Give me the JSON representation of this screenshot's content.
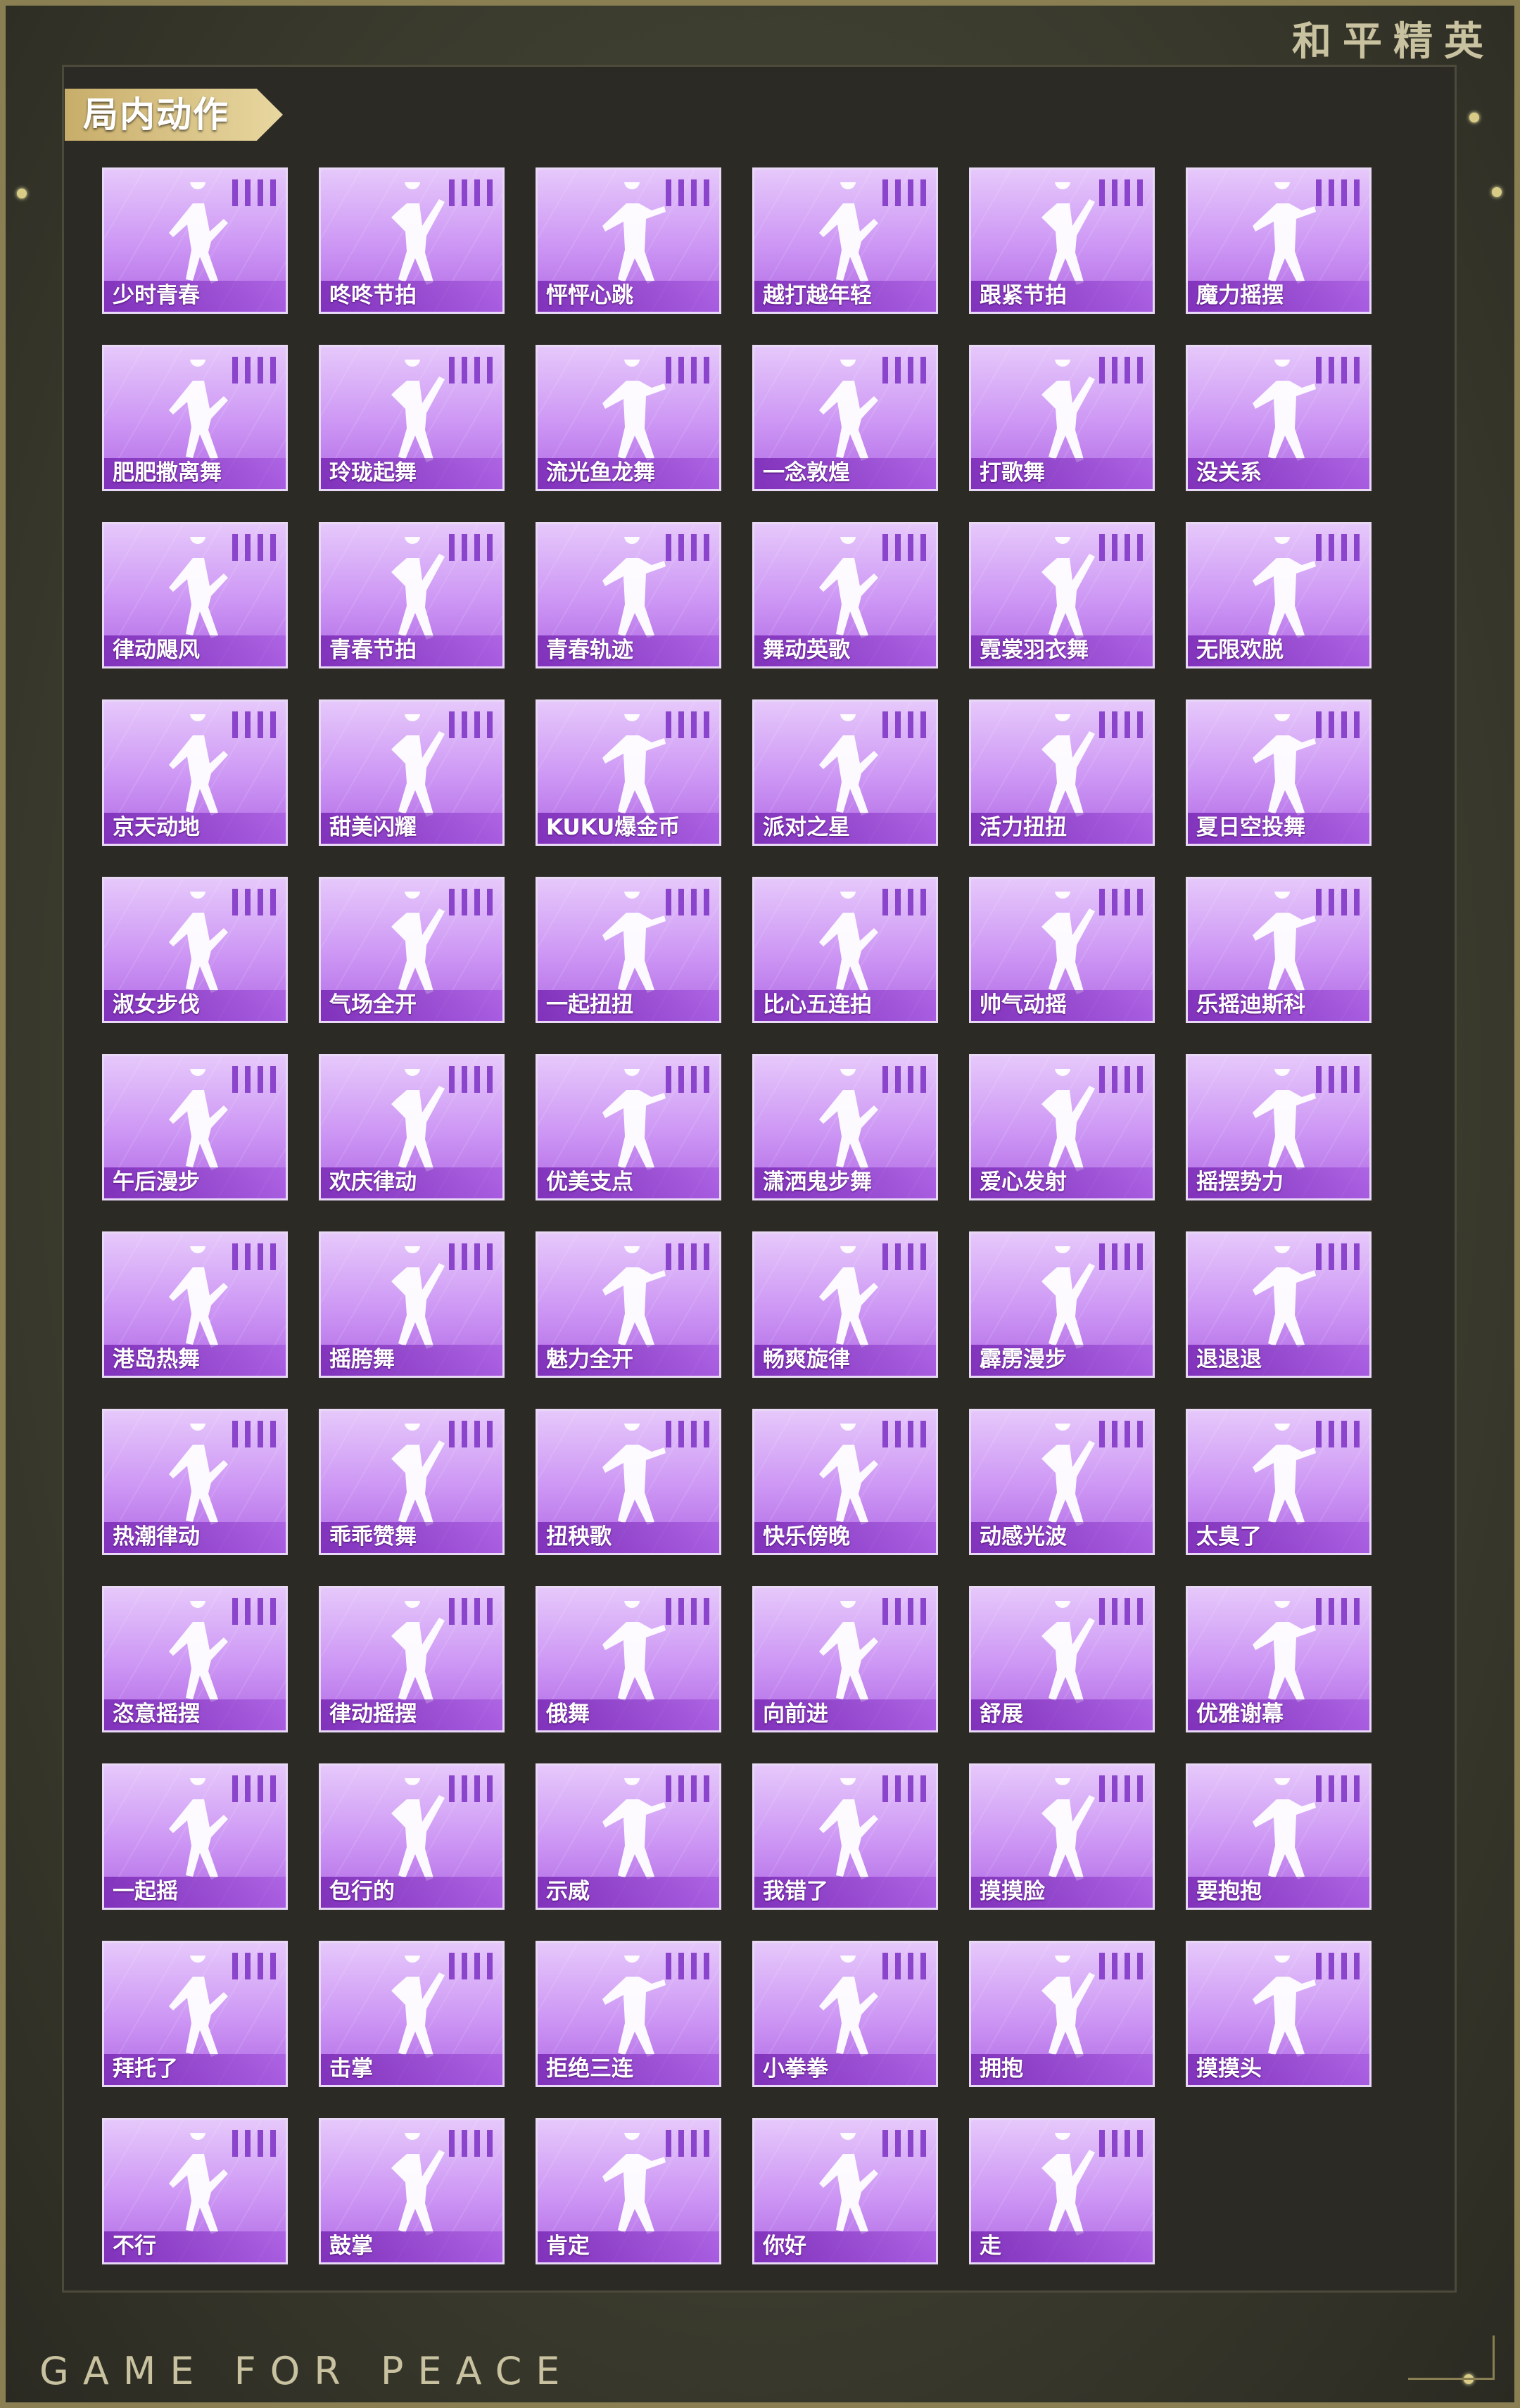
{
  "brand": "和平精英",
  "section_title": "局内动作",
  "footer": "GAME FOR PEACE",
  "figure_icon": "dancer-silhouette-icon",
  "actions": [
    "少时青春",
    "咚咚节拍",
    "怦怦心跳",
    "越打越年轻",
    "跟紧节拍",
    "魔力摇摆",
    "肥肥撒离舞",
    "玲珑起舞",
    "流光鱼龙舞",
    "一念敦煌",
    "打歌舞",
    "没关系",
    "律动飓风",
    "青春节拍",
    "青春轨迹",
    "舞动英歌",
    "霓裳羽衣舞",
    "无限欢脱",
    "京天动地",
    "甜美闪耀",
    "KUKU爆金币",
    "派对之星",
    "活力扭扭",
    "夏日空投舞",
    "淑女步伐",
    "气场全开",
    "一起扭扭",
    "比心五连拍",
    "帅气动摇",
    "乐摇迪斯科",
    "午后漫步",
    "欢庆律动",
    "优美支点",
    "潇洒鬼步舞",
    "爱心发射",
    "摇摆势力",
    "港岛热舞",
    "摇胯舞",
    "魅力全开",
    "畅爽旋律",
    "霹雳漫步",
    "退退退",
    "热潮律动",
    "乖乖赞舞",
    "扭秧歌",
    "快乐傍晚",
    "动感光波",
    "太臭了",
    "恣意摇摆",
    "律动摇摆",
    "俄舞",
    "向前进",
    "舒展",
    "优雅谢幕",
    "一起摇",
    "包行的",
    "示威",
    "我错了",
    "摸摸脸",
    "要抱抱",
    "拜托了",
    "击掌",
    "拒绝三连",
    "小拳拳",
    "拥抱",
    "摸摸头",
    "不行",
    "鼓掌",
    "肯定",
    "你好",
    "走"
  ]
}
